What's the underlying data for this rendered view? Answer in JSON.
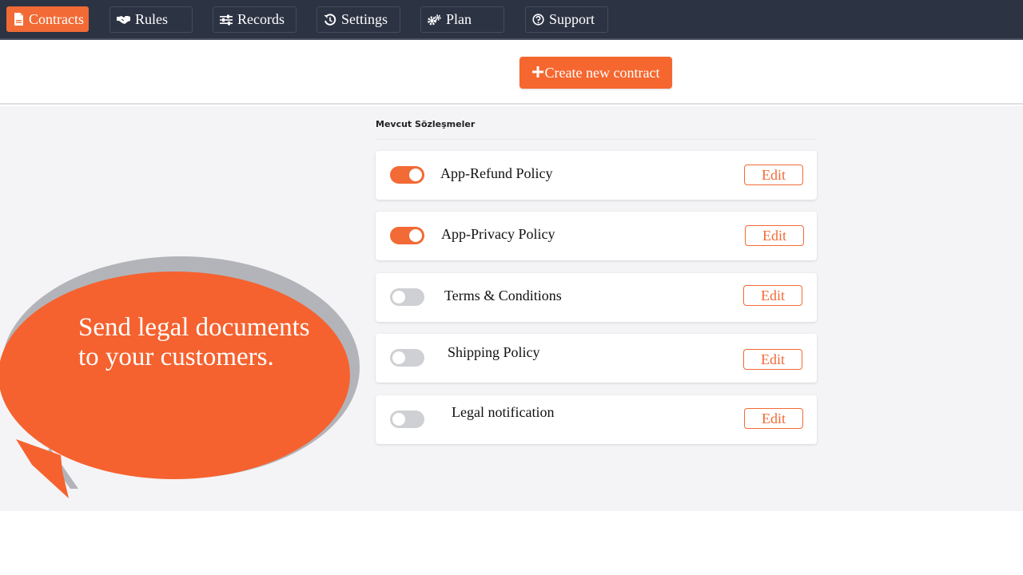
{
  "nav": {
    "items": [
      {
        "label": "Contracts",
        "icon": "document-icon",
        "active": true
      },
      {
        "label": "Rules",
        "icon": "handshake-icon",
        "active": false
      },
      {
        "label": "Records",
        "icon": "sliders-icon",
        "active": false
      },
      {
        "label": "Settings",
        "icon": "history-icon",
        "active": false
      },
      {
        "label": "Plan",
        "icon": "cogs-icon",
        "active": false
      },
      {
        "label": "Support",
        "icon": "question-circle-icon",
        "active": false
      }
    ]
  },
  "header": {
    "create_button_label": "Create new contract",
    "create_button_icon": "plus-icon"
  },
  "contracts": {
    "section_title": "Mevcut Sözleşmeler",
    "items": [
      {
        "name": "App-Refund Policy",
        "enabled": true,
        "edit_label": "Edit"
      },
      {
        "name": "App-Privacy Policy",
        "enabled": true,
        "edit_label": "Edit"
      },
      {
        "name": "Terms & Conditions",
        "enabled": false,
        "edit_label": "Edit"
      },
      {
        "name": "Shipping Policy",
        "enabled": false,
        "edit_label": "Edit"
      },
      {
        "name": "Legal notification",
        "enabled": false,
        "edit_label": "Edit"
      }
    ]
  },
  "promo": {
    "text": "Send legal documents to your customers."
  },
  "colors": {
    "accent": "#f26a35",
    "topbar": "#2c3343",
    "toggle_off": "#cfd0d3",
    "bubble": "#f5622f",
    "bubble_shadow": "#b3b4b9"
  }
}
